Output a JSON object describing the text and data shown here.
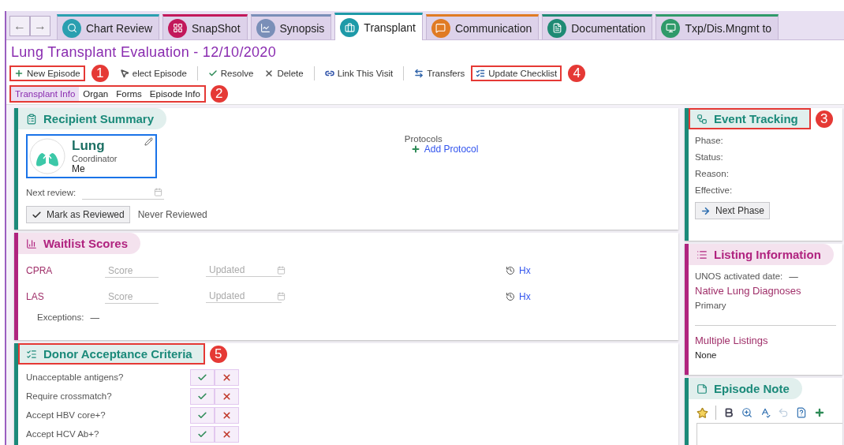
{
  "nav": {
    "back": "←",
    "forward": "→"
  },
  "tabs": [
    {
      "label": "Chart Review",
      "selected": false,
      "color": "#2a9fb0"
    },
    {
      "label": "SnapShot",
      "selected": false,
      "color": "#c2185b"
    },
    {
      "label": "Synopsis",
      "selected": false,
      "color": "#7a8fb8"
    },
    {
      "label": "Transplant",
      "selected": true,
      "color": "#1e9aa8"
    },
    {
      "label": "Communication",
      "selected": false,
      "color": "#e07b24"
    },
    {
      "label": "Documentation",
      "selected": false,
      "color": "#1f8a74"
    },
    {
      "label": "Txp/Dis.Mngmt to",
      "selected": false,
      "color": "#2f9a6a"
    }
  ],
  "title": "Lung Transplant Evaluation - 12/10/2020",
  "toolbar": [
    {
      "kind": "button",
      "label": "New Episode",
      "highlighted": true,
      "callout": "1"
    },
    {
      "kind": "button",
      "label": "elect Episode",
      "highlighted": false
    },
    {
      "kind": "separator"
    },
    {
      "kind": "button",
      "label": "Resolve",
      "highlighted": false
    },
    {
      "kind": "button",
      "label": "Delete",
      "highlighted": false
    },
    {
      "kind": "separator"
    },
    {
      "kind": "button",
      "label": "Link This Visit",
      "highlighted": false
    },
    {
      "kind": "separator"
    },
    {
      "kind": "button",
      "label": "Transfers",
      "highlighted": false
    },
    {
      "kind": "button",
      "label": "Update Checklist",
      "highlighted": true,
      "callout": "4"
    }
  ],
  "subtabs": {
    "highlighted": true,
    "callout": "2",
    "items": [
      {
        "label": "Transplant Info",
        "selected": true
      },
      {
        "label": "Organ",
        "selected": false
      },
      {
        "label": "Forms",
        "selected": false
      },
      {
        "label": "Episode Info",
        "selected": false
      }
    ]
  },
  "recipient_summary": {
    "title": "Recipient Summary",
    "color": "#1b8a7a",
    "highlighted": false,
    "organ_card": {
      "organ": "Lung",
      "role": "Coordinator",
      "person": "Me"
    },
    "next_review_label": "Next review:",
    "mark_button": "Mark as Reviewed",
    "review_status": "Never Reviewed",
    "protocols_label": "Protocols",
    "add_protocol": "Add Protocol"
  },
  "waitlist_scores": {
    "title": "Waitlist Scores",
    "color": "#b0237f",
    "highlighted": false,
    "rows": [
      {
        "name": "CPRA",
        "score_placeholder": "Score",
        "updated_placeholder": "Updated",
        "history": "Hx"
      },
      {
        "name": "LAS",
        "score_placeholder": "Score",
        "updated_placeholder": "Updated",
        "history": "Hx"
      }
    ],
    "exceptions_label": "Exceptions:",
    "exceptions_value": "—"
  },
  "donor_acceptance_criteria": {
    "title": "Donor Acceptance Criteria",
    "color": "#1b8a7a",
    "highlighted": true,
    "callout": "5",
    "questions": [
      "Unacceptable antigens?",
      "Require crossmatch?",
      "Accept HBV core+?",
      "Accept HCV Ab+?"
    ]
  },
  "event_tracking": {
    "title": "Event Tracking",
    "color": "#1b8a7a",
    "highlighted": true,
    "callout": "3",
    "fields": [
      "Phase:",
      "Status:",
      "Reason:",
      "Effective:"
    ],
    "next_button": "Next Phase"
  },
  "listing_information": {
    "title": "Listing Information",
    "color": "#b0237f",
    "highlighted": false,
    "unos_label": "UNOS activated date:",
    "unos_value": "—",
    "diagnoses_heading": "Native Lung Diagnoses",
    "diagnoses_label": "Primary",
    "multiple_heading": "Multiple Listings",
    "multiple_value": "None"
  },
  "episode_note": {
    "title": "Episode Note",
    "color": "#1b8a7a",
    "highlighted": false
  }
}
